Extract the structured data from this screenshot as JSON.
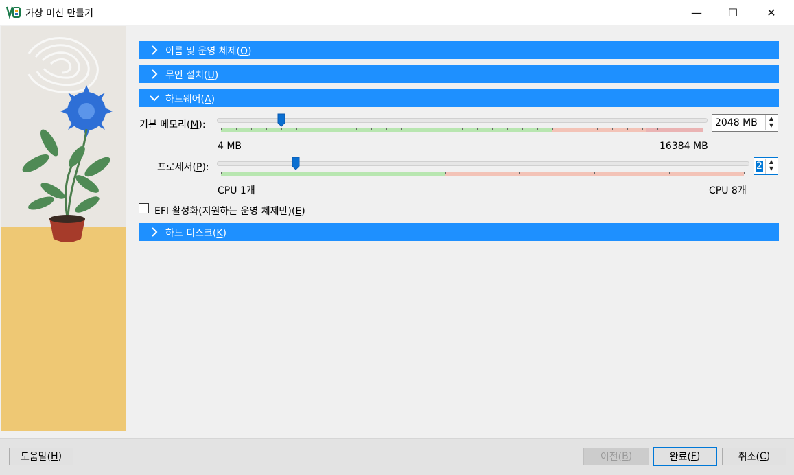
{
  "window": {
    "title": "가상 머신 만들기",
    "controls": {
      "minimize": "—",
      "maximize": "☐",
      "close": "✕"
    }
  },
  "sections": {
    "name_os": {
      "label": "이름 및 운영 체제(",
      "mnemonic": "O",
      "close": ")",
      "expanded": false
    },
    "unattended": {
      "label": "무인 설치(",
      "mnemonic": "U",
      "close": ")",
      "expanded": false
    },
    "hardware": {
      "label": "하드웨어(",
      "mnemonic": "A",
      "close": ")",
      "expanded": true
    },
    "hard_disk": {
      "label": "하드 디스크(",
      "mnemonic": "K",
      "close": ")",
      "expanded": false
    }
  },
  "memory": {
    "label": "기본 메모리(",
    "mnemonic": "M",
    "close": "):",
    "min_label": "4 MB",
    "max_label": "16384 MB",
    "value": 2048,
    "value_text": "2048 MB",
    "min": 4,
    "max": 16384
  },
  "processor": {
    "label": "프로세서(",
    "mnemonic": "P",
    "close": "):",
    "min_label": "CPU 1개",
    "max_label": "CPU 8개",
    "value": 2,
    "value_text": "2",
    "min": 1,
    "max": 8
  },
  "efi": {
    "label": "EFI 활성화(지원하는 운영 체제만)(",
    "mnemonic": "E",
    "close": ")",
    "checked": false
  },
  "buttons": {
    "help": {
      "label": "도움말(",
      "mnemonic": "H",
      "close": ")"
    },
    "back": {
      "label": "이전(",
      "mnemonic": "B",
      "close": ")",
      "enabled": false
    },
    "finish": {
      "label": "완료(",
      "mnemonic": "F",
      "close": ")"
    },
    "cancel": {
      "label": "취소(",
      "mnemonic": "C",
      "close": ")"
    }
  },
  "colors": {
    "accent": "#1e90ff",
    "good_zone": "#b8e6b0",
    "warn_zone": "#f3c3b7",
    "bad_zone": "#eab3b3"
  }
}
